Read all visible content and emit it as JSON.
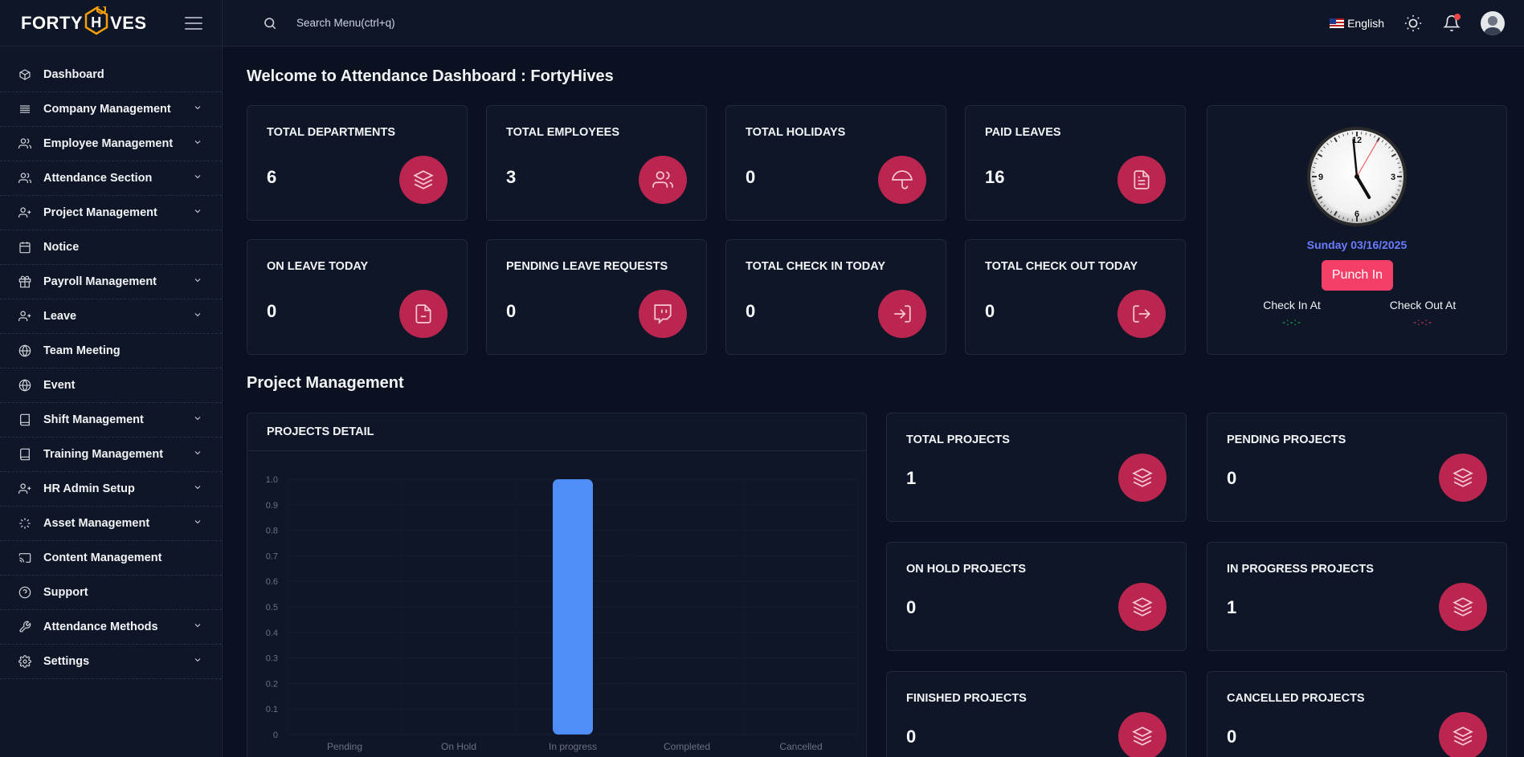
{
  "brand": {
    "name_part1": "FORTY",
    "name_part2": "H",
    "name_part3": "VES"
  },
  "sidebar": {
    "items": [
      {
        "label": "Dashboard",
        "icon": "box-icon",
        "expandable": false
      },
      {
        "label": "Company Management",
        "icon": "list-icon",
        "expandable": true
      },
      {
        "label": "Employee Management",
        "icon": "users-icon",
        "expandable": true
      },
      {
        "label": "Attendance Section",
        "icon": "users-icon",
        "expandable": true
      },
      {
        "label": "Project Management",
        "icon": "user-plus-icon",
        "expandable": true
      },
      {
        "label": "Notice",
        "icon": "calendar-icon",
        "expandable": false
      },
      {
        "label": "Payroll Management",
        "icon": "gift-icon",
        "expandable": true
      },
      {
        "label": "Leave",
        "icon": "user-plus-icon",
        "expandable": true
      },
      {
        "label": "Team Meeting",
        "icon": "globe-icon",
        "expandable": false
      },
      {
        "label": "Event",
        "icon": "globe-icon",
        "expandable": false
      },
      {
        "label": "Shift Management",
        "icon": "book-icon",
        "expandable": true
      },
      {
        "label": "Training Management",
        "icon": "book-icon",
        "expandable": true
      },
      {
        "label": "HR Admin Setup",
        "icon": "user-plus-icon",
        "expandable": true
      },
      {
        "label": "Asset Management",
        "icon": "loader-icon",
        "expandable": true
      },
      {
        "label": "Content Management",
        "icon": "cast-icon",
        "expandable": false
      },
      {
        "label": "Support",
        "icon": "help-circle-icon",
        "expandable": false
      },
      {
        "label": "Attendance Methods",
        "icon": "tool-icon",
        "expandable": true
      },
      {
        "label": "Settings",
        "icon": "gear-icon",
        "expandable": true
      }
    ]
  },
  "topbar": {
    "search_placeholder": "Search Menu(ctrl+q)",
    "language": "English"
  },
  "welcome": "Welcome to Attendance Dashboard : FortyHives",
  "stats": [
    {
      "title": "TOTAL DEPARTMENTS",
      "value": "6",
      "icon": "layers-icon"
    },
    {
      "title": "TOTAL EMPLOYEES",
      "value": "3",
      "icon": "users-icon"
    },
    {
      "title": "TOTAL HOLIDAYS",
      "value": "0",
      "icon": "umbrella-icon"
    },
    {
      "title": "PAID LEAVES",
      "value": "16",
      "icon": "file-text-icon"
    },
    {
      "title": "ON LEAVE TODAY",
      "value": "0",
      "icon": "file-minus-icon"
    },
    {
      "title": "PENDING LEAVE REQUESTS",
      "value": "0",
      "icon": "twitch-icon"
    },
    {
      "title": "TOTAL CHECK IN TODAY",
      "value": "0",
      "icon": "log-in-icon"
    },
    {
      "title": "TOTAL CHECK OUT TODAY",
      "value": "0",
      "icon": "log-out-icon"
    }
  ],
  "clock": {
    "date": "Sunday 03/16/2025",
    "punch_label": "Punch In",
    "check_in_label": "Check In At",
    "check_in_value": "-:-:-",
    "check_out_label": "Check Out At",
    "check_out_value": "-:-:-",
    "numerals": [
      "12",
      "3",
      "6",
      "9"
    ],
    "time_hours": 4,
    "time_minutes": 59,
    "time_seconds": 5,
    "check_in_color": "#22c55e",
    "check_out_color": "#f43f68"
  },
  "project_section_title": "Project Management",
  "projects_detail_title": "PROJECTS DETAIL",
  "project_stats": [
    {
      "title": "TOTAL PROJECTS",
      "value": "1"
    },
    {
      "title": "PENDING PROJECTS",
      "value": "0"
    },
    {
      "title": "ON HOLD PROJECTS",
      "value": "0"
    },
    {
      "title": "IN PROGRESS PROJECTS",
      "value": "1"
    },
    {
      "title": "FINISHED PROJECTS",
      "value": "0"
    },
    {
      "title": "CANCELLED PROJECTS",
      "value": "0"
    }
  ],
  "colors": {
    "accent": "#bb2650",
    "punch": "#f43f68",
    "bar": "#4f8ef7",
    "date": "#6b7cff"
  },
  "chart_data": {
    "type": "bar",
    "categories": [
      "Pending",
      "On Hold",
      "In progress",
      "Completed",
      "Cancelled"
    ],
    "values": [
      0,
      0,
      1,
      0,
      0
    ],
    "ylim": [
      0,
      1.0
    ],
    "yticks": [
      "0",
      "0.1",
      "0.2",
      "0.3",
      "0.4",
      "0.5",
      "0.6",
      "0.7",
      "0.8",
      "0.9",
      "1.0"
    ],
    "grid": true
  }
}
